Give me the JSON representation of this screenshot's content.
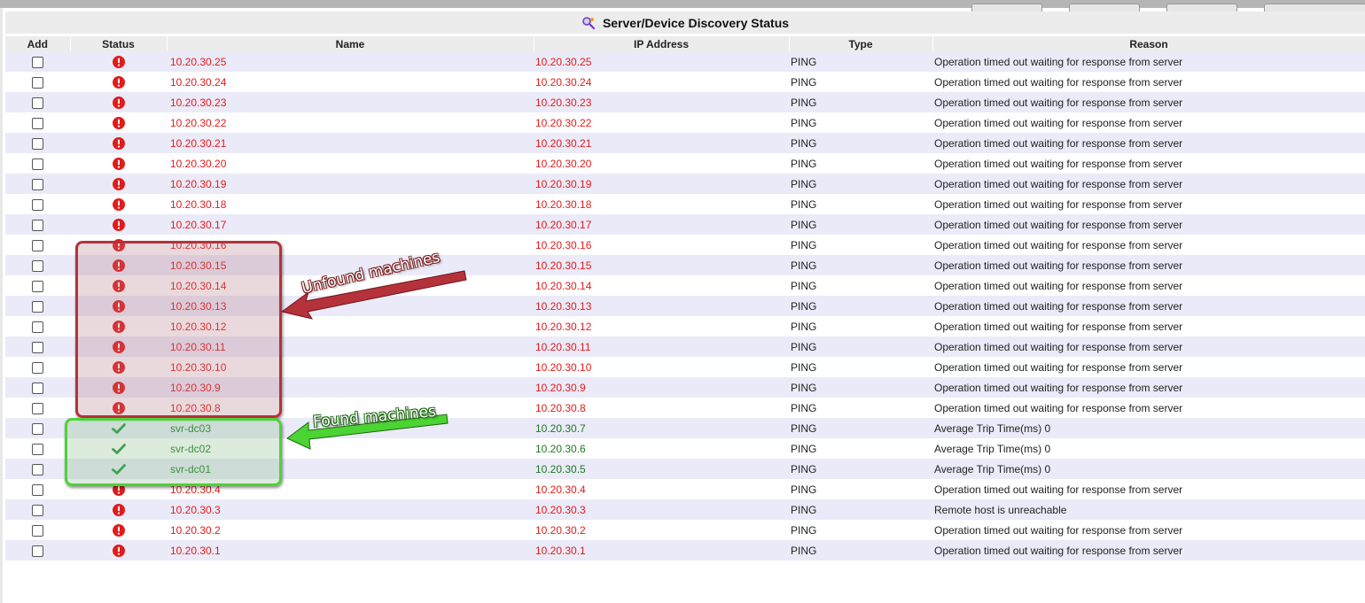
{
  "window": {
    "title": "Server/Device Discovery Status"
  },
  "columns": {
    "add": "Add",
    "status": "Status",
    "name": "Name",
    "ip": "IP Address",
    "type": "Type",
    "reason": "Reason"
  },
  "rows": [
    {
      "status": "error",
      "name": "10.20.30.25",
      "ip": "10.20.30.25",
      "type": "PING",
      "reason": "Operation timed out waiting for response from server"
    },
    {
      "status": "error",
      "name": "10.20.30.24",
      "ip": "10.20.30.24",
      "type": "PING",
      "reason": "Operation timed out waiting for response from server"
    },
    {
      "status": "error",
      "name": "10.20.30.23",
      "ip": "10.20.30.23",
      "type": "PING",
      "reason": "Operation timed out waiting for response from server"
    },
    {
      "status": "error",
      "name": "10.20.30.22",
      "ip": "10.20.30.22",
      "type": "PING",
      "reason": "Operation timed out waiting for response from server"
    },
    {
      "status": "error",
      "name": "10.20.30.21",
      "ip": "10.20.30.21",
      "type": "PING",
      "reason": "Operation timed out waiting for response from server"
    },
    {
      "status": "error",
      "name": "10.20.30.20",
      "ip": "10.20.30.20",
      "type": "PING",
      "reason": "Operation timed out waiting for response from server"
    },
    {
      "status": "error",
      "name": "10.20.30.19",
      "ip": "10.20.30.19",
      "type": "PING",
      "reason": "Operation timed out waiting for response from server"
    },
    {
      "status": "error",
      "name": "10.20.30.18",
      "ip": "10.20.30.18",
      "type": "PING",
      "reason": "Operation timed out waiting for response from server"
    },
    {
      "status": "error",
      "name": "10.20.30.17",
      "ip": "10.20.30.17",
      "type": "PING",
      "reason": "Operation timed out waiting for response from server"
    },
    {
      "status": "error",
      "name": "10.20.30.16",
      "ip": "10.20.30.16",
      "type": "PING",
      "reason": "Operation timed out waiting for response from server"
    },
    {
      "status": "error",
      "name": "10.20.30.15",
      "ip": "10.20.30.15",
      "type": "PING",
      "reason": "Operation timed out waiting for response from server"
    },
    {
      "status": "error",
      "name": "10.20.30.14",
      "ip": "10.20.30.14",
      "type": "PING",
      "reason": "Operation timed out waiting for response from server"
    },
    {
      "status": "error",
      "name": "10.20.30.13",
      "ip": "10.20.30.13",
      "type": "PING",
      "reason": "Operation timed out waiting for response from server"
    },
    {
      "status": "error",
      "name": "10.20.30.12",
      "ip": "10.20.30.12",
      "type": "PING",
      "reason": "Operation timed out waiting for response from server"
    },
    {
      "status": "error",
      "name": "10.20.30.11",
      "ip": "10.20.30.11",
      "type": "PING",
      "reason": "Operation timed out waiting for response from server"
    },
    {
      "status": "error",
      "name": "10.20.30.10",
      "ip": "10.20.30.10",
      "type": "PING",
      "reason": "Operation timed out waiting for response from server"
    },
    {
      "status": "error",
      "name": "10.20.30.9",
      "ip": "10.20.30.9",
      "type": "PING",
      "reason": "Operation timed out waiting for response from server"
    },
    {
      "status": "error",
      "name": "10.20.30.8",
      "ip": "10.20.30.8",
      "type": "PING",
      "reason": "Operation timed out waiting for response from server"
    },
    {
      "status": "ok",
      "name": "svr-dc03",
      "ip": "10.20.30.7",
      "type": "PING",
      "reason": "Average Trip Time(ms) 0"
    },
    {
      "status": "ok",
      "name": "svr-dc02",
      "ip": "10.20.30.6",
      "type": "PING",
      "reason": "Average Trip Time(ms) 0"
    },
    {
      "status": "ok",
      "name": "svr-dc01",
      "ip": "10.20.30.5",
      "type": "PING",
      "reason": "Average Trip Time(ms) 0"
    },
    {
      "status": "error",
      "name": "10.20.30.4",
      "ip": "10.20.30.4",
      "type": "PING",
      "reason": "Operation timed out waiting for response from server"
    },
    {
      "status": "error",
      "name": "10.20.30.3",
      "ip": "10.20.30.3",
      "type": "PING",
      "reason": "Remote host is unreachable"
    },
    {
      "status": "error",
      "name": "10.20.30.2",
      "ip": "10.20.30.2",
      "type": "PING",
      "reason": "Operation timed out waiting for response from server"
    },
    {
      "status": "error",
      "name": "10.20.30.1",
      "ip": "10.20.30.1",
      "type": "PING",
      "reason": "Operation timed out waiting for response from server"
    }
  ],
  "annotations": {
    "unfound": "Unfound machines",
    "found": "Found machines"
  },
  "colors": {
    "error": "#e21b1b",
    "ok": "#1d7a1d",
    "row_alt": "#eaeaf8",
    "header": "#ececec"
  },
  "icons": {
    "title": "discover-magnifier-icon",
    "error": "error-exclamation-icon",
    "ok": "checkmark-icon"
  }
}
